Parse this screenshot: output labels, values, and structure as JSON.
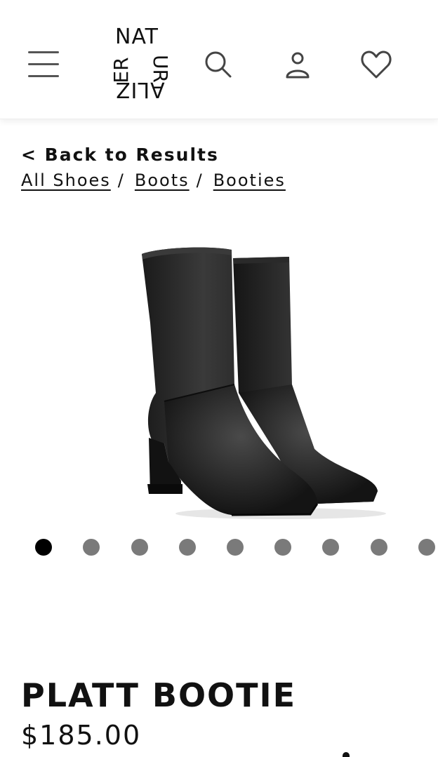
{
  "header": {
    "logo": {
      "top": "NAT",
      "left_column": "ER",
      "right_column": "UR",
      "bottom": "ALIZ"
    },
    "icons": [
      "menu-icon",
      "search-icon",
      "account-icon",
      "heart-icon"
    ]
  },
  "navigation": {
    "back_label": "< Back to Results",
    "breadcrumbs": [
      "All Shoes",
      "Boots",
      "Booties"
    ],
    "separator": "/"
  },
  "gallery": {
    "total_images": 9,
    "active_index": 0
  },
  "product": {
    "name": "PLATT BOOTIE",
    "price": "$185.00"
  },
  "colors": {
    "text": "#111111",
    "dot_inactive": "#7a7a7a",
    "dot_active": "#000000",
    "menu_bars": "#555555",
    "icons": "#444444"
  }
}
